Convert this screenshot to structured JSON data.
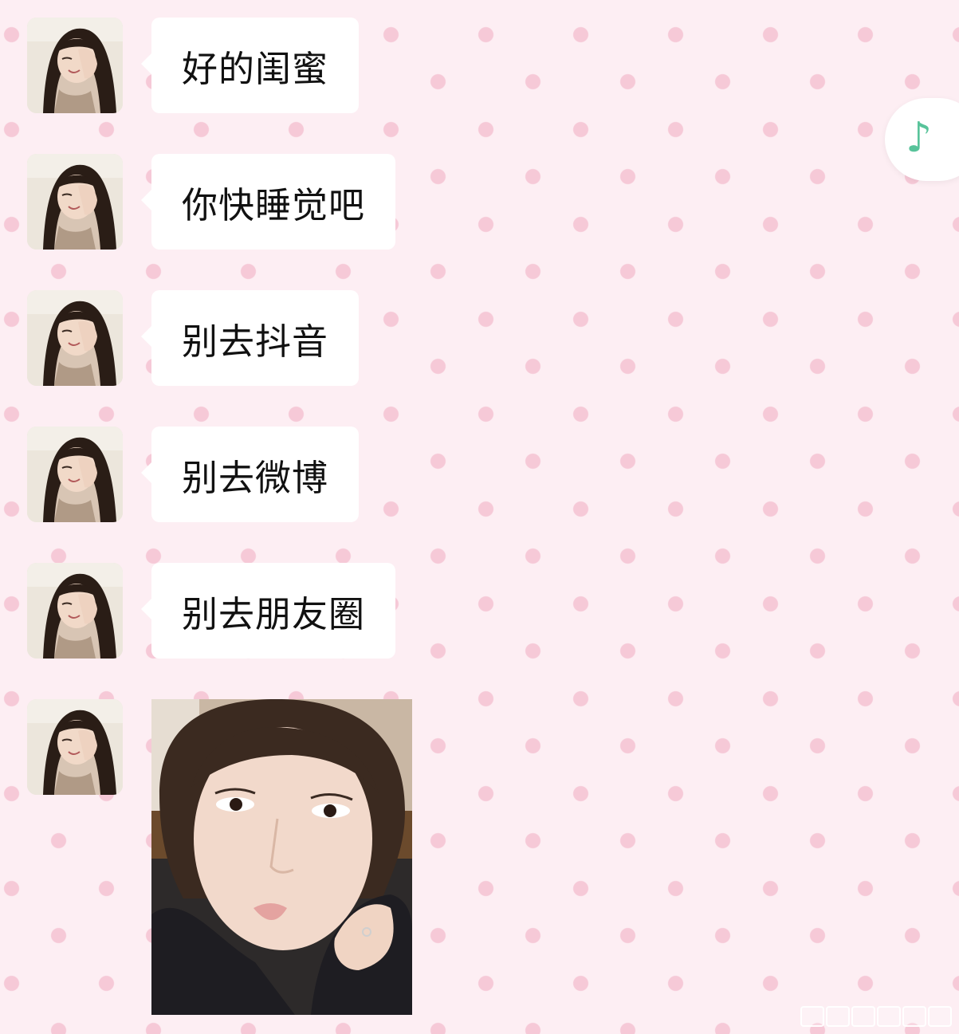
{
  "conversation": {
    "messages": [
      {
        "sender": "friend",
        "text": "好的闺蜜"
      },
      {
        "sender": "friend",
        "text": "你快睡觉吧"
      },
      {
        "sender": "friend",
        "text": "别去抖音"
      },
      {
        "sender": "friend",
        "text": "别去微博"
      },
      {
        "sender": "friend",
        "text": "别去朋友圈"
      }
    ],
    "image_message": {
      "sender": "friend",
      "kind": "photo"
    }
  },
  "floating_button": {
    "icon": "music-note-icon",
    "glyph": "♪",
    "color": "#58c39a"
  },
  "theme": {
    "background": "#fdeef3",
    "dot_color": "#f6c9d7",
    "bubble_color": "#ffffff"
  }
}
